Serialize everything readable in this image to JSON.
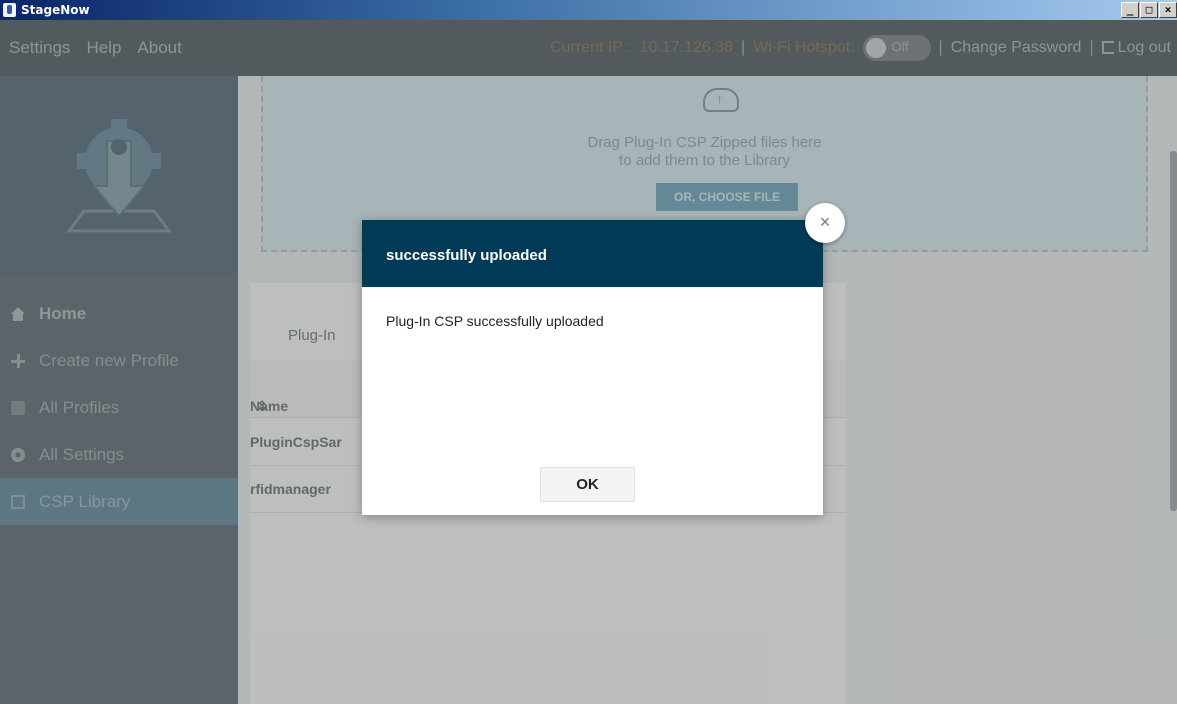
{
  "window": {
    "title": "StageNow",
    "controls": [
      "_",
      "□",
      "×"
    ]
  },
  "topnav": {
    "menu": [
      "Settings",
      "Help",
      "About"
    ],
    "ip_label": "Current IP :",
    "ip_value": "10.17.126.38",
    "hotspot_label": "Wi-Fi Hotspot:",
    "hotspot_state": "Off",
    "change_password": "Change Password",
    "logout": "Log out"
  },
  "sidebar": {
    "items": [
      {
        "label": "Home",
        "icon": "home-icon"
      },
      {
        "label": "Create new Profile",
        "icon": "plus-icon"
      },
      {
        "label": "All Profiles",
        "icon": "profiles-icon"
      },
      {
        "label": "All Settings",
        "icon": "gear-icon"
      },
      {
        "label": "CSP Library",
        "icon": "library-icon",
        "active": true
      }
    ]
  },
  "dropzone": {
    "line1": "Drag Plug-In CSP Zipped files here",
    "line2": "to add them to the Library",
    "button": "OR, CHOOSE FILE"
  },
  "table": {
    "tab": "Plug-In",
    "header_name": "Name",
    "rows": [
      "PluginCspSar",
      "rfidmanager"
    ]
  },
  "dialog": {
    "title": "successfully uploaded",
    "message": "Plug-In CSP successfully uploaded",
    "ok": "OK",
    "close": "×"
  },
  "colors": {
    "dialog_header": "#003a57",
    "active_nav": "#3e6e84",
    "topnav_bg": "#2f3b41"
  }
}
